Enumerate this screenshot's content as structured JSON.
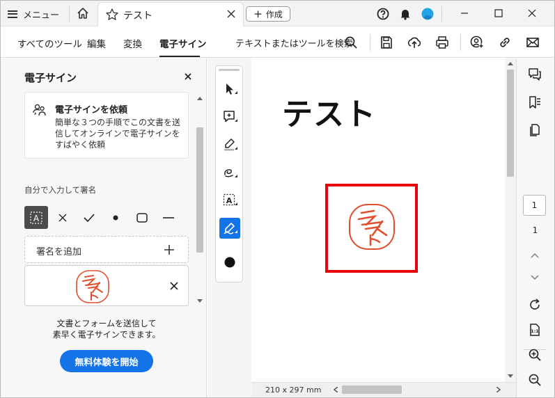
{
  "titlebar": {
    "menu_label": "メニュー",
    "tab_title": "テスト",
    "create_label": "作成",
    "icons": [
      "hamburger-icon",
      "home-icon",
      "star-icon",
      "close-icon",
      "help-icon",
      "bell-icon",
      "avatar",
      "minimize-icon",
      "maximize-icon",
      "close-window-icon"
    ]
  },
  "toolbar": {
    "nav": [
      "すべてのツール",
      "編集",
      "変換",
      "電子サイン"
    ],
    "active_nav": "電子サイン",
    "search_label": "テキストまたはツールを検索",
    "icons": [
      "search-icon",
      "save-icon",
      "upload-icon",
      "print-icon",
      "add-user-icon",
      "link-icon",
      "mail-icon"
    ]
  },
  "panel": {
    "title": "電子サイン",
    "request_card": {
      "title": "電子サインを依頼",
      "description": "簡単な３つの手順でこの文書を送信してオンラインで電子サインをすばやく依頼"
    },
    "self_sign_label": "自分で入力して署名",
    "add_signature_label": "署名を追加",
    "promo_line1": "文書とフォームを送信して",
    "promo_line2": "素早く電子サインできます。",
    "trial_button": "無料体験を開始"
  },
  "stamp": {
    "text": "テスト",
    "color": "#e05030"
  },
  "document": {
    "title": "テスト",
    "page_size": "210 x 297 mm",
    "box_color": "#e8000b"
  },
  "pager": {
    "current_page": "1",
    "total_pages": "1"
  },
  "colors": {
    "accent": "#1473e6",
    "stamp_red": "#e05030"
  }
}
